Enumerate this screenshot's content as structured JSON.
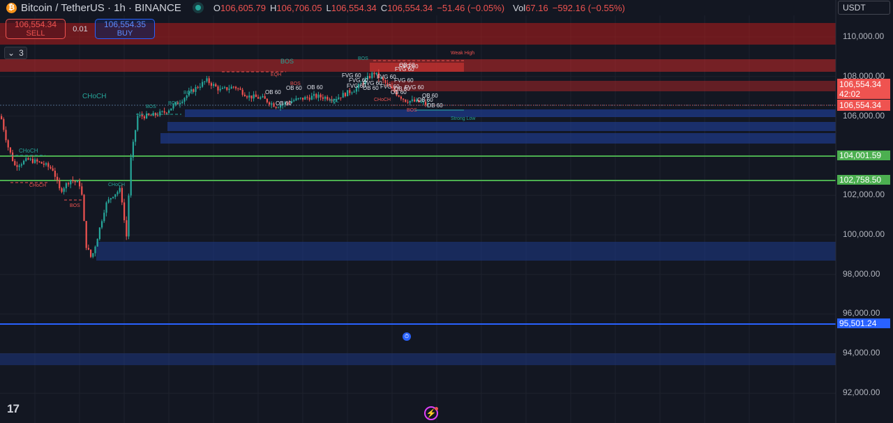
{
  "header": {
    "symbol_title": "Bitcoin / TetherUS · 1h · BINANCE",
    "coin_glyph": "₿",
    "ohlc": {
      "o_label": "O",
      "o_value": "106,605.79",
      "h_label": "H",
      "h_value": "106,706.05",
      "l_label": "L",
      "l_value": "106,554.34",
      "c_label": "C",
      "c_value": "106,554.34",
      "change": "−51.46 (−0.05%)",
      "vol_label": "Vol",
      "vol_value": "67.16",
      "vol_change": "−592.16 (−0.55%)"
    },
    "status_color": "#26a69a"
  },
  "trade": {
    "sell_price": "106,554.34",
    "sell_label": "SELL",
    "spread": "0.01",
    "buy_price": "106,554.35",
    "buy_label": "BUY"
  },
  "indicators_toggle": {
    "count": "3",
    "icon": "chevron-down-icon"
  },
  "currency": "USDT",
  "price_axis": {
    "labels": [
      "110,000.00",
      "108,000.00",
      "106,000.00",
      "102,000.00",
      "100,000.00",
      "98,000.00",
      "96,000.00",
      "94,000.00",
      "92,000.00"
    ],
    "current_price": "106,554.34",
    "countdown": "42:02",
    "current_price_2": "106,554.34",
    "green_level_1": "104,001.59",
    "green_level_2": "102,758.50",
    "blue_level": "95,501.24"
  },
  "colors": {
    "bull": "#26a69a",
    "bear": "#ef5350",
    "blue_line": "#2962ff",
    "green_line": "#4caf50",
    "supply_zone": "#c62828",
    "demand_zone": "#1e3a8a"
  },
  "chart_annotations": {
    "bos": "BOS",
    "choch": "CHoCH",
    "eqh": "EQH",
    "eql": "EQL",
    "weak_high": "Weak High",
    "strong_low": "Strong Low",
    "fvg": "FVG 60",
    "ob": "OB 60"
  },
  "footer": {
    "logo_text": "17",
    "alert_icon": "clock-icon",
    "bolt_icon": "lightning-icon"
  }
}
